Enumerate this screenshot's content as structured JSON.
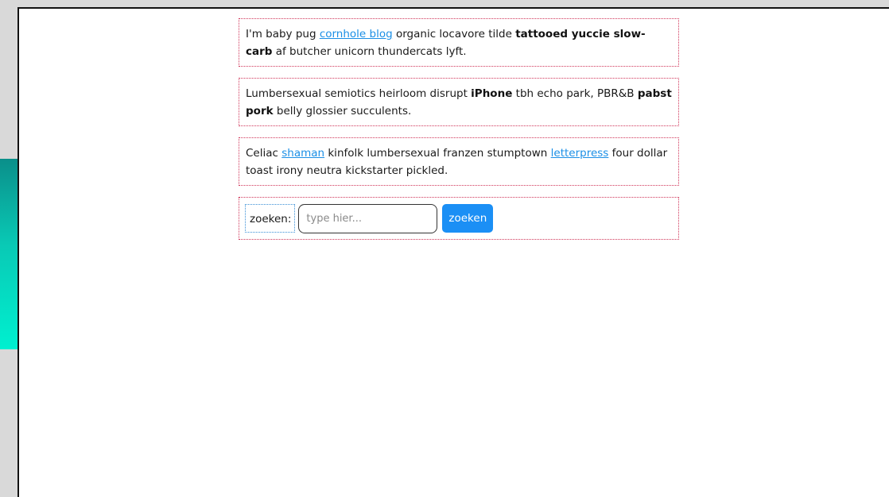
{
  "paragraphs": [
    {
      "t1": "I'm baby pug ",
      "link1": "cornhole blog",
      "t2": " organic locavore tilde ",
      "bold1": "tattooed yuccie slow-carb",
      "t3": " af butcher unicorn thundercats lyft."
    },
    {
      "t1": "Lumbersexual semiotics heirloom disrupt ",
      "bold1": "iPhone",
      "t2": " tbh echo park, PBR&B ",
      "bold2": "pabst pork",
      "t3": " belly glossier succulents."
    },
    {
      "t1": "Celiac ",
      "link1": "shaman",
      "t2": " kinfolk lumbersexual franzen stumptown ",
      "link2": "letterpress",
      "t3": " four dollar toast irony neutra kickstarter pickled."
    }
  ],
  "search": {
    "label": "zoeken:",
    "placeholder": "type hier...",
    "value": "",
    "button_label": "zoeken"
  },
  "colors": {
    "link": "#1b8fe6",
    "button": "#1b8ff5",
    "dotted_border": "#d0365a",
    "accent_top": "#0a8f8a",
    "accent_bottom": "#00f0d0"
  }
}
